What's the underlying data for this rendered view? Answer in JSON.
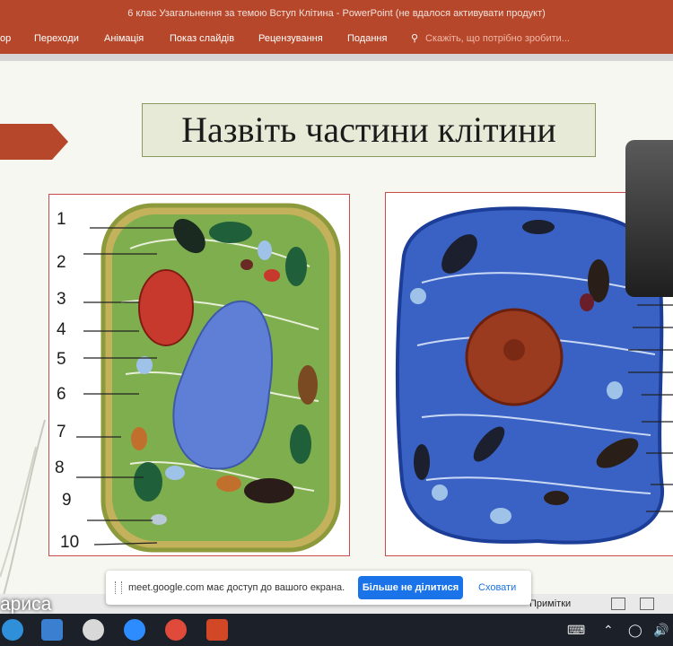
{
  "window": {
    "title": "6 клас Узагальнення за темою Вступ Клітина - PowerPoint (не вдалося активувати продукт)"
  },
  "ribbon": {
    "tabs": [
      "ор",
      "Переходи",
      "Анімація",
      "Показ слайдів",
      "Рецензування",
      "Подання"
    ],
    "search_placeholder": "Скажіть, що потрібно зробити..."
  },
  "slide": {
    "title": "Назвіть частини клітини",
    "labels": [
      "1",
      "2",
      "3",
      "4",
      "5",
      "6",
      "7",
      "8",
      "9",
      "10"
    ]
  },
  "share_bar": {
    "message": "meet.google.com має доступ до вашого екрана.",
    "stop_label": "Більше не ділитися",
    "hide_label": "Сховати"
  },
  "status": {
    "notes_label": "Примітки",
    "caller_name": "ариса"
  },
  "colors": {
    "ppt_red": "#b7472a",
    "share_blue": "#1a73e8",
    "taskbar": "#1c2129"
  }
}
